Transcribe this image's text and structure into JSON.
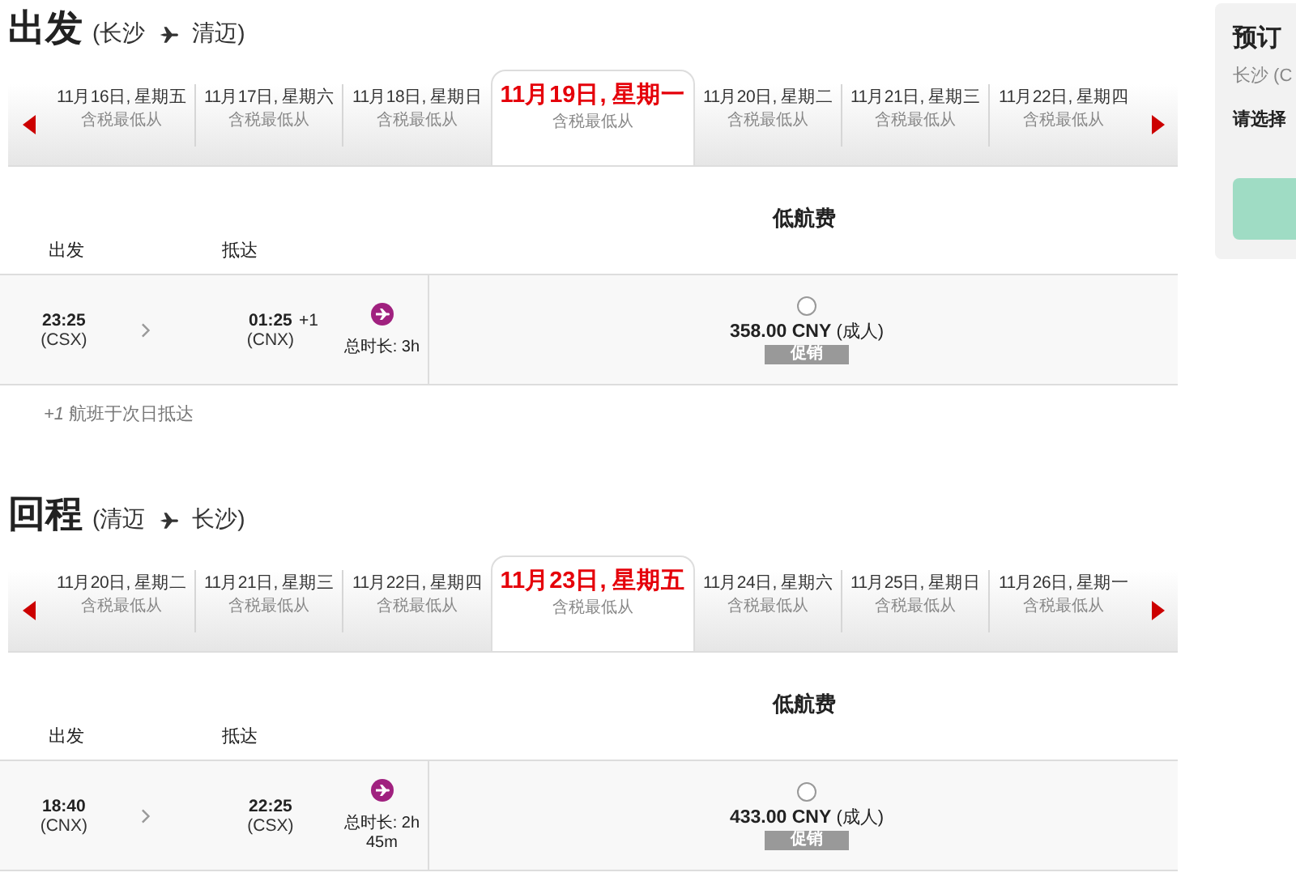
{
  "sections": [
    {
      "title": "出发",
      "route": {
        "from": "(长沙",
        "to": "清迈)"
      },
      "dates": [
        {
          "date": "11月16日, 星期五",
          "note": "含税最低从",
          "selected": false
        },
        {
          "date": "11月17日, 星期六",
          "note": "含税最低从",
          "selected": false
        },
        {
          "date": "11月18日, 星期日",
          "note": "含税最低从",
          "selected": false
        },
        {
          "date": "11月19日, 星期一",
          "note": "含税最低从",
          "selected": true
        },
        {
          "date": "11月20日, 星期二",
          "note": "含税最低从",
          "selected": false
        },
        {
          "date": "11月21日, 星期三",
          "note": "含税最低从",
          "selected": false
        },
        {
          "date": "11月22日, 星期四",
          "note": "含税最低从",
          "selected": false
        }
      ],
      "fare_header": "低航费",
      "columns": [
        "出发",
        "抵达"
      ],
      "flights": [
        {
          "depart_time": "23:25",
          "depart_code": "(CSX)",
          "arrive_time": "01:25",
          "day_offset": "+1",
          "arrive_code": "(CNX)",
          "duration": "总时长: 3h",
          "fare": {
            "price": "358.00 CNY",
            "passenger": "(成人)",
            "tag": "促销",
            "selected": false
          }
        }
      ],
      "footnote": "*+1* 航班于次日抵达"
    },
    {
      "title": "回程",
      "route": {
        "from": "(清迈",
        "to": "长沙)"
      },
      "dates": [
        {
          "date": "11月20日, 星期二",
          "note": "含税最低从",
          "selected": false
        },
        {
          "date": "11月21日, 星期三",
          "note": "含税最低从",
          "selected": false
        },
        {
          "date": "11月22日, 星期四",
          "note": "含税最低从",
          "selected": false
        },
        {
          "date": "11月23日, 星期五",
          "note": "含税最低从",
          "selected": true
        },
        {
          "date": "11月24日, 星期六",
          "note": "含税最低从",
          "selected": false
        },
        {
          "date": "11月25日, 星期日",
          "note": "含税最低从",
          "selected": false
        },
        {
          "date": "11月26日, 星期一",
          "note": "含税最低从",
          "selected": false
        }
      ],
      "fare_header": "低航费",
      "columns": [
        "出发",
        "抵达"
      ],
      "flights": [
        {
          "depart_time": "18:40",
          "depart_code": "(CNX)",
          "arrive_time": "22:25",
          "arrive_code": "(CSX)",
          "duration": "总时长: 2h 45m",
          "fare": {
            "price": "433.00 CNY",
            "passenger": "(成人)",
            "tag": "促销",
            "selected": false
          }
        }
      ]
    }
  ],
  "summary": {
    "title": "预订",
    "route": "长沙 (C",
    "prompt": "请选择"
  }
}
